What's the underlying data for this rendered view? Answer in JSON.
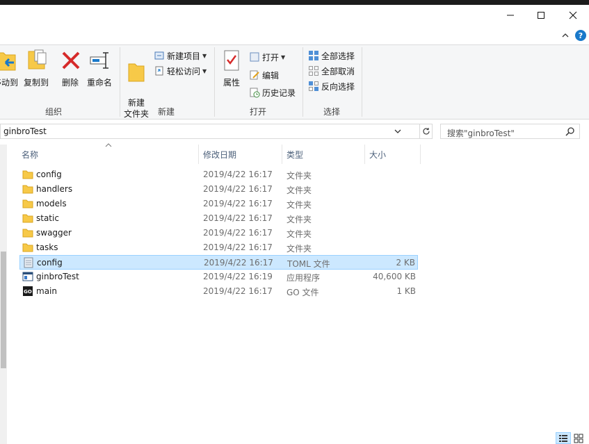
{
  "window": {
    "minimize_icon": "minimize-icon",
    "maximize_icon": "maximize-icon",
    "close_icon": "close-icon",
    "help_label": "?"
  },
  "ribbon": {
    "groups": [
      {
        "label": "组织"
      },
      {
        "label": "新建"
      },
      {
        "label": "打开"
      },
      {
        "label": "选择"
      }
    ],
    "move_to_label": "移动到",
    "copy_to_label": "复制到",
    "delete_label": "删除",
    "rename_label": "重命名",
    "new_folder_label": "新建\n文件夹",
    "new_item_label": "新建项目",
    "easy_access_label": "轻松访问",
    "properties_label": "属性",
    "open_label": "打开",
    "edit_label": "编辑",
    "history_label": "历史记录",
    "select_all_label": "全部选择",
    "select_none_label": "全部取消",
    "invert_selection_label": "反向选择"
  },
  "address": {
    "path": "ginbroTest",
    "search_placeholder": "搜索\"ginbroTest\""
  },
  "columns": {
    "name": "名称",
    "date": "修改日期",
    "type": "类型",
    "size": "大小"
  },
  "files": [
    {
      "name": "config",
      "date": "2019/4/22 16:17",
      "type": "文件夹",
      "size": "",
      "icon": "folder-icon"
    },
    {
      "name": "handlers",
      "date": "2019/4/22 16:17",
      "type": "文件夹",
      "size": "",
      "icon": "folder-icon"
    },
    {
      "name": "models",
      "date": "2019/4/22 16:17",
      "type": "文件夹",
      "size": "",
      "icon": "folder-icon"
    },
    {
      "name": "static",
      "date": "2019/4/22 16:17",
      "type": "文件夹",
      "size": "",
      "icon": "folder-icon"
    },
    {
      "name": "swagger",
      "date": "2019/4/22 16:17",
      "type": "文件夹",
      "size": "",
      "icon": "folder-icon"
    },
    {
      "name": "tasks",
      "date": "2019/4/22 16:17",
      "type": "文件夹",
      "size": "",
      "icon": "folder-icon"
    },
    {
      "name": "config",
      "date": "2019/4/22 16:17",
      "type": "TOML 文件",
      "size": "2 KB",
      "icon": "toml-file-icon",
      "selected": true
    },
    {
      "name": "ginbroTest",
      "date": "2019/4/22 16:19",
      "type": "应用程序",
      "size": "40,600 KB",
      "icon": "application-icon"
    },
    {
      "name": "main",
      "date": "2019/4/22 16:17",
      "type": "GO 文件",
      "size": "1 KB",
      "icon": "go-file-icon"
    }
  ],
  "colors": {
    "selection_bg": "#cce8ff",
    "selection_border": "#99d1ff",
    "folder": "#f7c948",
    "header_text": "#4c607a",
    "accent": "#1979ca"
  }
}
